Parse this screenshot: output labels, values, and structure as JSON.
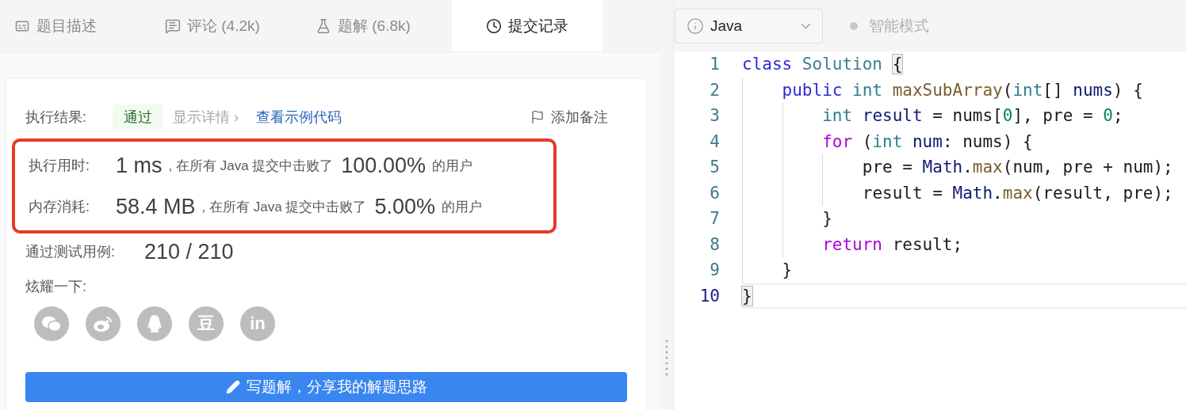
{
  "tabs": [
    {
      "label": "题目描述",
      "kind": "description",
      "selected": false
    },
    {
      "label": "评论 (4.2k)",
      "kind": "comments",
      "selected": false
    },
    {
      "label": "题解 (6.8k)",
      "kind": "solutions",
      "selected": false
    },
    {
      "label": "提交记录",
      "kind": "submissions",
      "selected": true
    }
  ],
  "result": {
    "label": "执行结果:",
    "status": "通过",
    "details_link": "显示详情 ›",
    "example_link": "查看示例代码",
    "note_button": "添加备注"
  },
  "stats": {
    "highlighted": true,
    "rows": [
      {
        "label": "执行用时:",
        "value": "1 ms",
        "text": ", 在所有 Java 提交中击败了",
        "percent": "100.00%",
        "suffix": "的用户"
      },
      {
        "label": "内存消耗:",
        "value": "58.4 MB",
        "text": ", 在所有 Java 提交中击败了",
        "percent": "5.00%",
        "suffix": "的用户"
      }
    ]
  },
  "testcases": {
    "label": "通过测试用例:",
    "value": "210 / 210"
  },
  "share": {
    "label": "炫耀一下:",
    "buttons": [
      {
        "kind": "wechat"
      },
      {
        "kind": "weibo"
      },
      {
        "kind": "qq"
      },
      {
        "kind": "douban",
        "label": "豆"
      },
      {
        "kind": "linkedin",
        "label": "in"
      }
    ]
  },
  "write_button": "写题解，分享我的解题思路",
  "editor": {
    "language": "Java",
    "smart_mode": {
      "label": "智能模式",
      "on": false
    },
    "lines": [
      {
        "number": "1",
        "current": false,
        "tokens": [
          {
            "kind": "keyword",
            "text": "class"
          },
          {
            "kind": "class",
            "text": " Solution "
          },
          {
            "kind": "match",
            "text": "{"
          }
        ]
      },
      {
        "number": "2",
        "current": false,
        "tokens": [
          {
            "kind": "keyword",
            "text": "    public"
          },
          {
            "kind": "type",
            "text": " int"
          },
          {
            "kind": "method",
            "text": " maxSubArray"
          },
          {
            "kind": "plain",
            "text": "("
          },
          {
            "kind": "type",
            "text": "int"
          },
          {
            "kind": "plain",
            "text": "[]"
          },
          {
            "kind": "variable",
            "text": " nums"
          },
          {
            "kind": "plain",
            "text": ") {"
          }
        ]
      },
      {
        "number": "3",
        "current": false,
        "tokens": [
          {
            "kind": "type",
            "text": "        int"
          },
          {
            "kind": "variable",
            "text": " result"
          },
          {
            "kind": "plain",
            "text": " = nums["
          },
          {
            "kind": "number",
            "text": "0"
          },
          {
            "kind": "plain",
            "text": "], pre = "
          },
          {
            "kind": "number",
            "text": "0"
          },
          {
            "kind": "plain",
            "text": ";"
          }
        ]
      },
      {
        "number": "4",
        "current": false,
        "tokens": [
          {
            "kind": "control",
            "text": "        for"
          },
          {
            "kind": "plain",
            "text": " ("
          },
          {
            "kind": "type",
            "text": "int"
          },
          {
            "kind": "variable",
            "text": " num:"
          },
          {
            "kind": "plain",
            "text": " nums) {"
          }
        ]
      },
      {
        "number": "5",
        "current": false,
        "tokens": [
          {
            "kind": "plain",
            "text": "            pre = "
          },
          {
            "kind": "variable",
            "text": "Math"
          },
          {
            "kind": "plain",
            "text": "."
          },
          {
            "kind": "method",
            "text": "max"
          },
          {
            "kind": "plain",
            "text": "(num, pre + num);"
          }
        ]
      },
      {
        "number": "6",
        "current": false,
        "tokens": [
          {
            "kind": "plain",
            "text": "            result = "
          },
          {
            "kind": "variable",
            "text": "Math"
          },
          {
            "kind": "plain",
            "text": "."
          },
          {
            "kind": "method",
            "text": "max"
          },
          {
            "kind": "plain",
            "text": "(result, pre);"
          }
        ]
      },
      {
        "number": "7",
        "current": false,
        "tokens": [
          {
            "kind": "plain",
            "text": "        }"
          }
        ]
      },
      {
        "number": "8",
        "current": false,
        "tokens": [
          {
            "kind": "control",
            "text": "        return"
          },
          {
            "kind": "plain",
            "text": " result;"
          }
        ]
      },
      {
        "number": "9",
        "current": false,
        "tokens": [
          {
            "kind": "plain",
            "text": "    }"
          }
        ]
      },
      {
        "number": "10",
        "current": true,
        "tokens": [
          {
            "kind": "match",
            "text": "}"
          }
        ]
      }
    ]
  }
}
